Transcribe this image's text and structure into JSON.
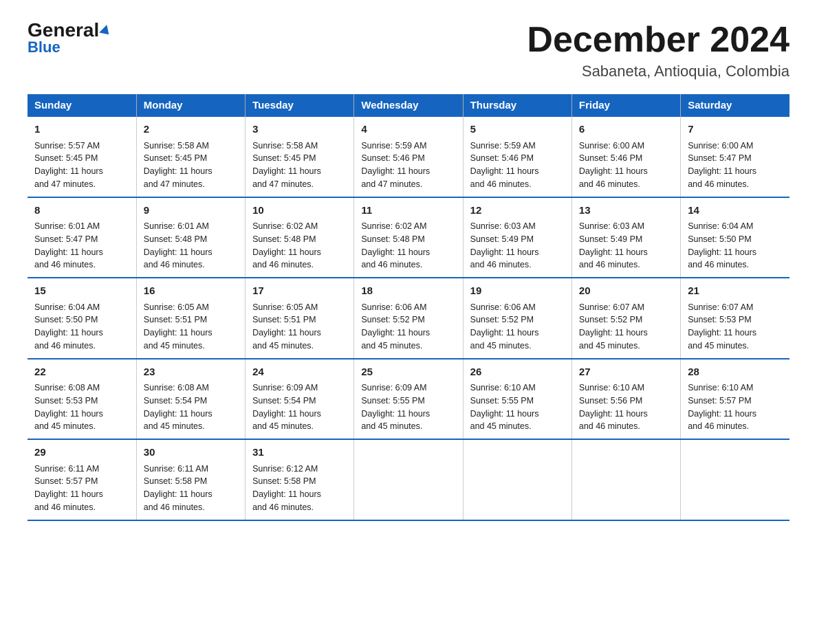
{
  "logo": {
    "general": "General",
    "blue": "Blue",
    "arrow_symbol": "▶"
  },
  "header": {
    "month": "December 2024",
    "location": "Sabaneta, Antioquia, Colombia"
  },
  "days_of_week": [
    "Sunday",
    "Monday",
    "Tuesday",
    "Wednesday",
    "Thursday",
    "Friday",
    "Saturday"
  ],
  "weeks": [
    [
      {
        "day": "1",
        "sunrise": "5:57 AM",
        "sunset": "5:45 PM",
        "daylight": "11 hours and 47 minutes."
      },
      {
        "day": "2",
        "sunrise": "5:58 AM",
        "sunset": "5:45 PM",
        "daylight": "11 hours and 47 minutes."
      },
      {
        "day": "3",
        "sunrise": "5:58 AM",
        "sunset": "5:45 PM",
        "daylight": "11 hours and 47 minutes."
      },
      {
        "day": "4",
        "sunrise": "5:59 AM",
        "sunset": "5:46 PM",
        "daylight": "11 hours and 47 minutes."
      },
      {
        "day": "5",
        "sunrise": "5:59 AM",
        "sunset": "5:46 PM",
        "daylight": "11 hours and 46 minutes."
      },
      {
        "day": "6",
        "sunrise": "6:00 AM",
        "sunset": "5:46 PM",
        "daylight": "11 hours and 46 minutes."
      },
      {
        "day": "7",
        "sunrise": "6:00 AM",
        "sunset": "5:47 PM",
        "daylight": "11 hours and 46 minutes."
      }
    ],
    [
      {
        "day": "8",
        "sunrise": "6:01 AM",
        "sunset": "5:47 PM",
        "daylight": "11 hours and 46 minutes."
      },
      {
        "day": "9",
        "sunrise": "6:01 AM",
        "sunset": "5:48 PM",
        "daylight": "11 hours and 46 minutes."
      },
      {
        "day": "10",
        "sunrise": "6:02 AM",
        "sunset": "5:48 PM",
        "daylight": "11 hours and 46 minutes."
      },
      {
        "day": "11",
        "sunrise": "6:02 AM",
        "sunset": "5:48 PM",
        "daylight": "11 hours and 46 minutes."
      },
      {
        "day": "12",
        "sunrise": "6:03 AM",
        "sunset": "5:49 PM",
        "daylight": "11 hours and 46 minutes."
      },
      {
        "day": "13",
        "sunrise": "6:03 AM",
        "sunset": "5:49 PM",
        "daylight": "11 hours and 46 minutes."
      },
      {
        "day": "14",
        "sunrise": "6:04 AM",
        "sunset": "5:50 PM",
        "daylight": "11 hours and 46 minutes."
      }
    ],
    [
      {
        "day": "15",
        "sunrise": "6:04 AM",
        "sunset": "5:50 PM",
        "daylight": "11 hours and 46 minutes."
      },
      {
        "day": "16",
        "sunrise": "6:05 AM",
        "sunset": "5:51 PM",
        "daylight": "11 hours and 45 minutes."
      },
      {
        "day": "17",
        "sunrise": "6:05 AM",
        "sunset": "5:51 PM",
        "daylight": "11 hours and 45 minutes."
      },
      {
        "day": "18",
        "sunrise": "6:06 AM",
        "sunset": "5:52 PM",
        "daylight": "11 hours and 45 minutes."
      },
      {
        "day": "19",
        "sunrise": "6:06 AM",
        "sunset": "5:52 PM",
        "daylight": "11 hours and 45 minutes."
      },
      {
        "day": "20",
        "sunrise": "6:07 AM",
        "sunset": "5:52 PM",
        "daylight": "11 hours and 45 minutes."
      },
      {
        "day": "21",
        "sunrise": "6:07 AM",
        "sunset": "5:53 PM",
        "daylight": "11 hours and 45 minutes."
      }
    ],
    [
      {
        "day": "22",
        "sunrise": "6:08 AM",
        "sunset": "5:53 PM",
        "daylight": "11 hours and 45 minutes."
      },
      {
        "day": "23",
        "sunrise": "6:08 AM",
        "sunset": "5:54 PM",
        "daylight": "11 hours and 45 minutes."
      },
      {
        "day": "24",
        "sunrise": "6:09 AM",
        "sunset": "5:54 PM",
        "daylight": "11 hours and 45 minutes."
      },
      {
        "day": "25",
        "sunrise": "6:09 AM",
        "sunset": "5:55 PM",
        "daylight": "11 hours and 45 minutes."
      },
      {
        "day": "26",
        "sunrise": "6:10 AM",
        "sunset": "5:55 PM",
        "daylight": "11 hours and 45 minutes."
      },
      {
        "day": "27",
        "sunrise": "6:10 AM",
        "sunset": "5:56 PM",
        "daylight": "11 hours and 46 minutes."
      },
      {
        "day": "28",
        "sunrise": "6:10 AM",
        "sunset": "5:57 PM",
        "daylight": "11 hours and 46 minutes."
      }
    ],
    [
      {
        "day": "29",
        "sunrise": "6:11 AM",
        "sunset": "5:57 PM",
        "daylight": "11 hours and 46 minutes."
      },
      {
        "day": "30",
        "sunrise": "6:11 AM",
        "sunset": "5:58 PM",
        "daylight": "11 hours and 46 minutes."
      },
      {
        "day": "31",
        "sunrise": "6:12 AM",
        "sunset": "5:58 PM",
        "daylight": "11 hours and 46 minutes."
      },
      null,
      null,
      null,
      null
    ]
  ],
  "labels": {
    "sunrise": "Sunrise:",
    "sunset": "Sunset:",
    "daylight": "Daylight:"
  }
}
